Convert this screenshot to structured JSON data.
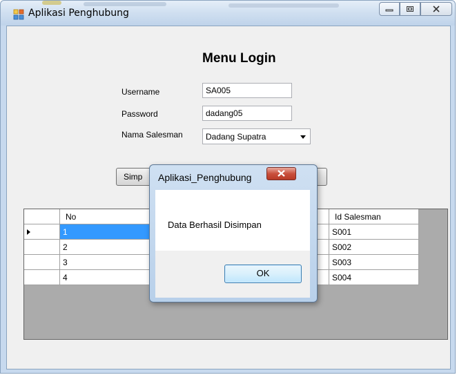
{
  "window": {
    "title": "Aplikasi Penghubung"
  },
  "form": {
    "heading": "Menu Login",
    "username_label": "Username",
    "username_value": "SA005",
    "password_label": "Password",
    "password_value": "dadang05",
    "salesman_label": "Nama Salesman",
    "salesman_value": "Dadang Supatra",
    "save_button_visible": "Simp"
  },
  "grid": {
    "headers": [
      "No",
      "Id Salesman"
    ],
    "rows": [
      {
        "no": "1",
        "id": "S001"
      },
      {
        "no": "2",
        "id": "S002"
      },
      {
        "no": "3",
        "id": "S003"
      },
      {
        "no": "4",
        "id": "S004"
      }
    ],
    "selected_row": 1
  },
  "dialog": {
    "title": "Aplikasi_Penghubung",
    "message": "Data Berhasil Disimpan",
    "ok_label": "OK"
  },
  "colors": {
    "selection": "#3399ff",
    "grid_bg": "#ababab"
  }
}
